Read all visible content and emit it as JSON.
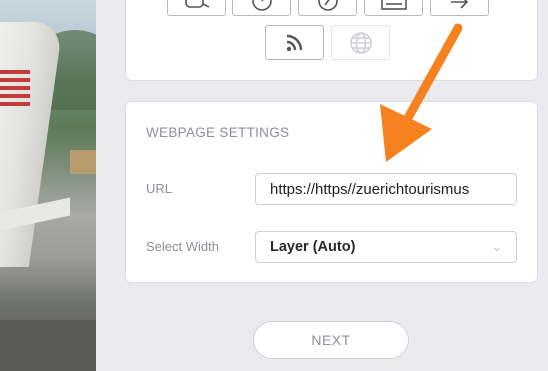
{
  "media_icons": [
    {
      "name": "video-icon",
      "enabled": true
    },
    {
      "name": "gauge-icon",
      "enabled": true
    },
    {
      "name": "compass-icon",
      "enabled": true
    },
    {
      "name": "text-block-icon",
      "enabled": true
    },
    {
      "name": "share-arrow-icon",
      "enabled": true
    },
    {
      "name": "rss-icon",
      "enabled": true
    },
    {
      "name": "globe-icon",
      "enabled": false
    }
  ],
  "webpage_settings": {
    "title": "WEBPAGE SETTINGS",
    "url_label": "URL",
    "url_value": "https://https//zuerichtourismus",
    "width_label": "Select Width",
    "width_value": "Layer (Auto)"
  },
  "next_button": "NEXT",
  "annotation": {
    "arrow_color": "#f5821f"
  }
}
